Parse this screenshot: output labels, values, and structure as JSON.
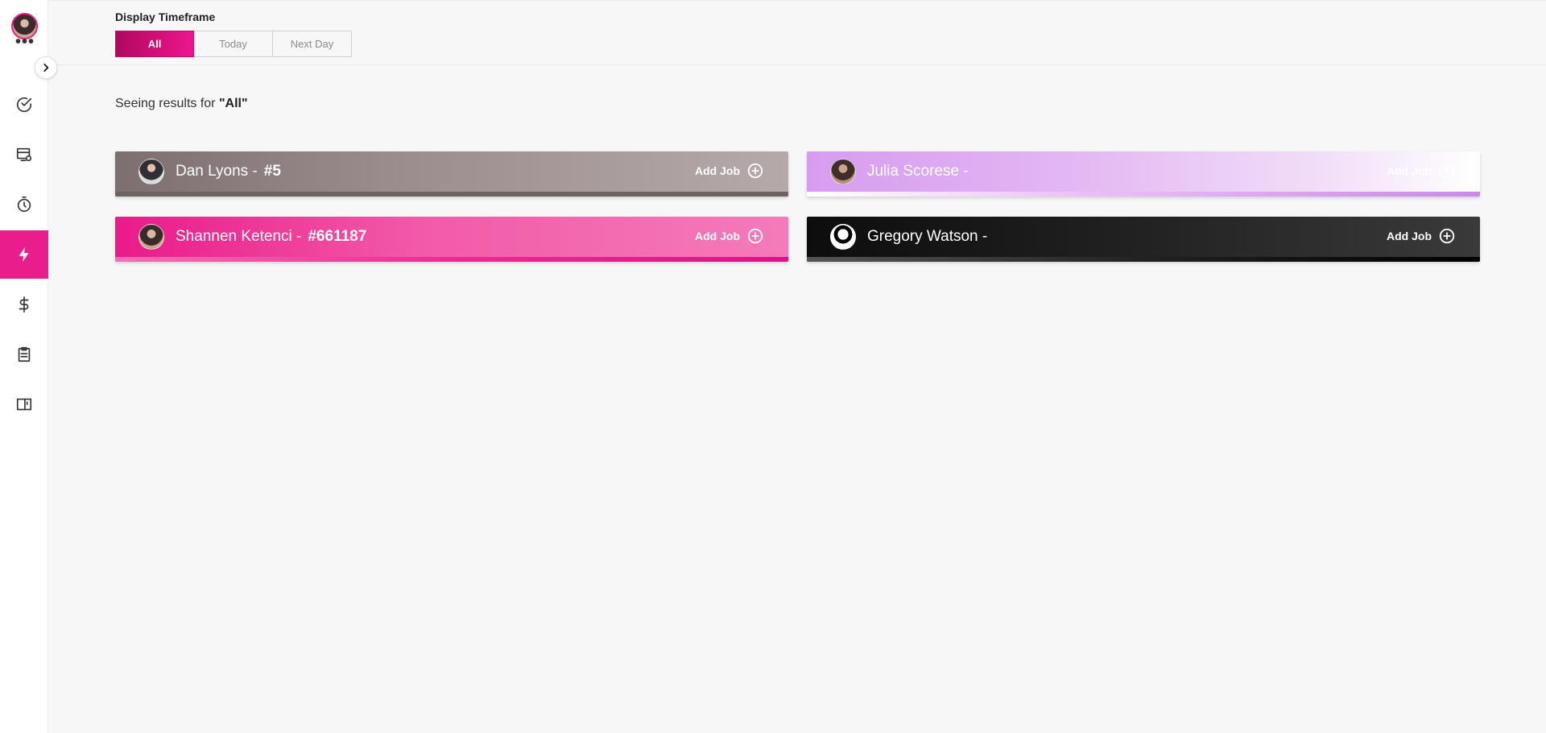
{
  "sidebar": {
    "user_avatar": "user-avatar",
    "more": "•••",
    "expand_icon": "chevron-right-icon",
    "items": [
      {
        "icon": "check-circle-icon",
        "active": false
      },
      {
        "icon": "board-settings-icon",
        "active": false
      },
      {
        "icon": "stopwatch-icon",
        "active": false
      },
      {
        "icon": "lightning-icon",
        "active": true
      },
      {
        "icon": "dollar-icon",
        "active": false
      },
      {
        "icon": "clipboard-icon",
        "active": false
      },
      {
        "icon": "book-icon",
        "active": false
      }
    ]
  },
  "header": {
    "timeframe_label": "Display Timeframe",
    "timeframe_options": [
      "All",
      "Today",
      "Next Day"
    ],
    "timeframe_selected": "All"
  },
  "results": {
    "prefix": "Seeing results for ",
    "query": "\"All\""
  },
  "cards": [
    {
      "name": "Dan Lyons -",
      "number": "#5",
      "add_label": "Add Job",
      "color": "#9a8c8c"
    },
    {
      "name": "Julia Scorese -",
      "number": "",
      "add_label": "Add Job",
      "color": "#d79cf0"
    },
    {
      "name": "Shannen Ketenci -",
      "number": "#661187",
      "add_label": "Add Job",
      "color": "#ea1a8a"
    },
    {
      "name": "Gregory Watson -",
      "number": "",
      "add_label": "Add Job",
      "color": "#111111"
    }
  ],
  "colors": {
    "accent": "#e91e8c",
    "background": "#f7f7f7"
  }
}
